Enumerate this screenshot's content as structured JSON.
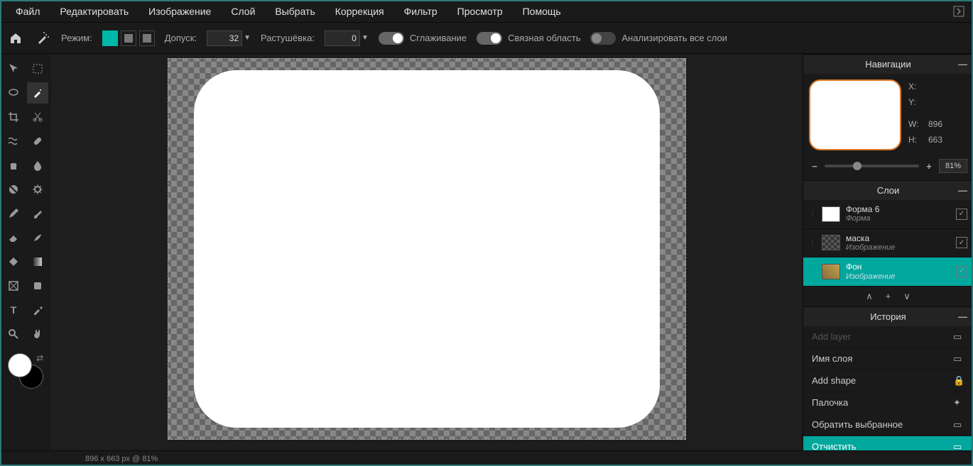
{
  "menu": [
    "Файл",
    "Редактировать",
    "Изображение",
    "Слой",
    "Выбрать",
    "Коррекция",
    "Фильтр",
    "Просмотр",
    "Помощь"
  ],
  "options": {
    "mode_label": "Режим:",
    "tolerance_label": "Допуск:",
    "tolerance_value": "32",
    "feather_label": "Растушёвка:",
    "feather_value": "0",
    "antialias_label": "Сглаживание",
    "contiguous_label": "Связная область",
    "all_layers_label": "Анализировать все слои"
  },
  "nav": {
    "title": "Навигации",
    "x_label": "X:",
    "y_label": "Y:",
    "w_label": "W:",
    "h_label": "H:",
    "w_value": "896",
    "h_value": "663",
    "zoom_value": "81%"
  },
  "layers_panel": {
    "title": "Слои",
    "items": [
      {
        "name": "Форма 6",
        "type": "Форма"
      },
      {
        "name": "маска",
        "type": "Изображение"
      },
      {
        "name": "Фон",
        "type": "Изображение"
      }
    ]
  },
  "history_panel": {
    "title": "История",
    "items": [
      {
        "label": "Add layer"
      },
      {
        "label": "Имя слоя"
      },
      {
        "label": "Add shape"
      },
      {
        "label": "Палочка"
      },
      {
        "label": "Обратить выбранное"
      },
      {
        "label": "Отчистить"
      }
    ]
  },
  "status": "896 x 663 px @ 81%"
}
